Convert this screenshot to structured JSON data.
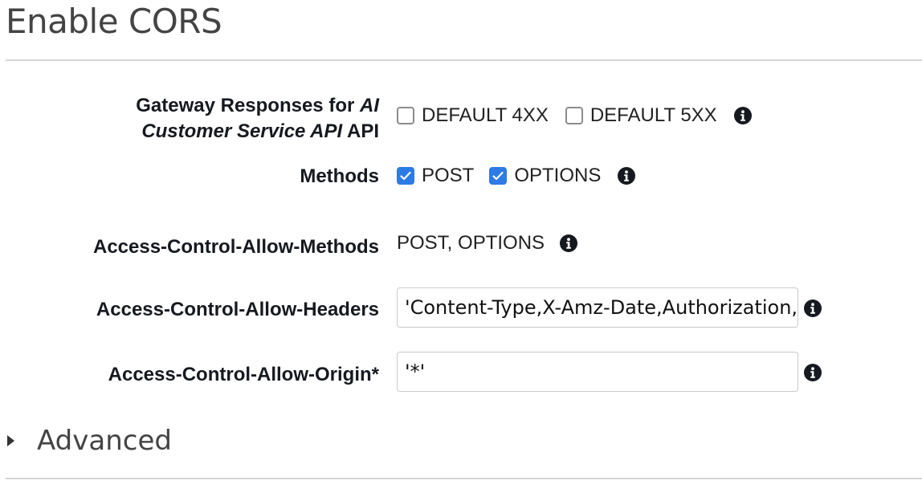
{
  "page": {
    "title": "Enable CORS"
  },
  "gateway_responses": {
    "label_prefix": "Gateway Responses for",
    "api_name_line1": "AI",
    "api_name_line2": "Customer Service API",
    "label_suffix": "API",
    "options": [
      {
        "label": "DEFAULT 4XX",
        "checked": false
      },
      {
        "label": "DEFAULT 5XX",
        "checked": false
      }
    ]
  },
  "methods": {
    "label": "Methods",
    "options": [
      {
        "label": "POST",
        "checked": true
      },
      {
        "label": "OPTIONS",
        "checked": true
      }
    ]
  },
  "allow_methods": {
    "label": "Access-Control-Allow-Methods",
    "value": "POST, OPTIONS"
  },
  "allow_headers": {
    "label": "Access-Control-Allow-Headers",
    "value": "'Content-Type,X-Amz-Date,Authorization,X-Api-Key,X-Amz-Security-Token'"
  },
  "allow_origin": {
    "label": "Access-Control-Allow-Origin*",
    "value": "'*'"
  },
  "advanced": {
    "label": "Advanced"
  },
  "colors": {
    "accent": "#2d7be5",
    "text": "#16191f",
    "muted": "#444444",
    "border": "#c9c9c9"
  },
  "icons": {
    "info": "info-icon",
    "check": "check-icon",
    "expand": "caret-right-icon"
  }
}
